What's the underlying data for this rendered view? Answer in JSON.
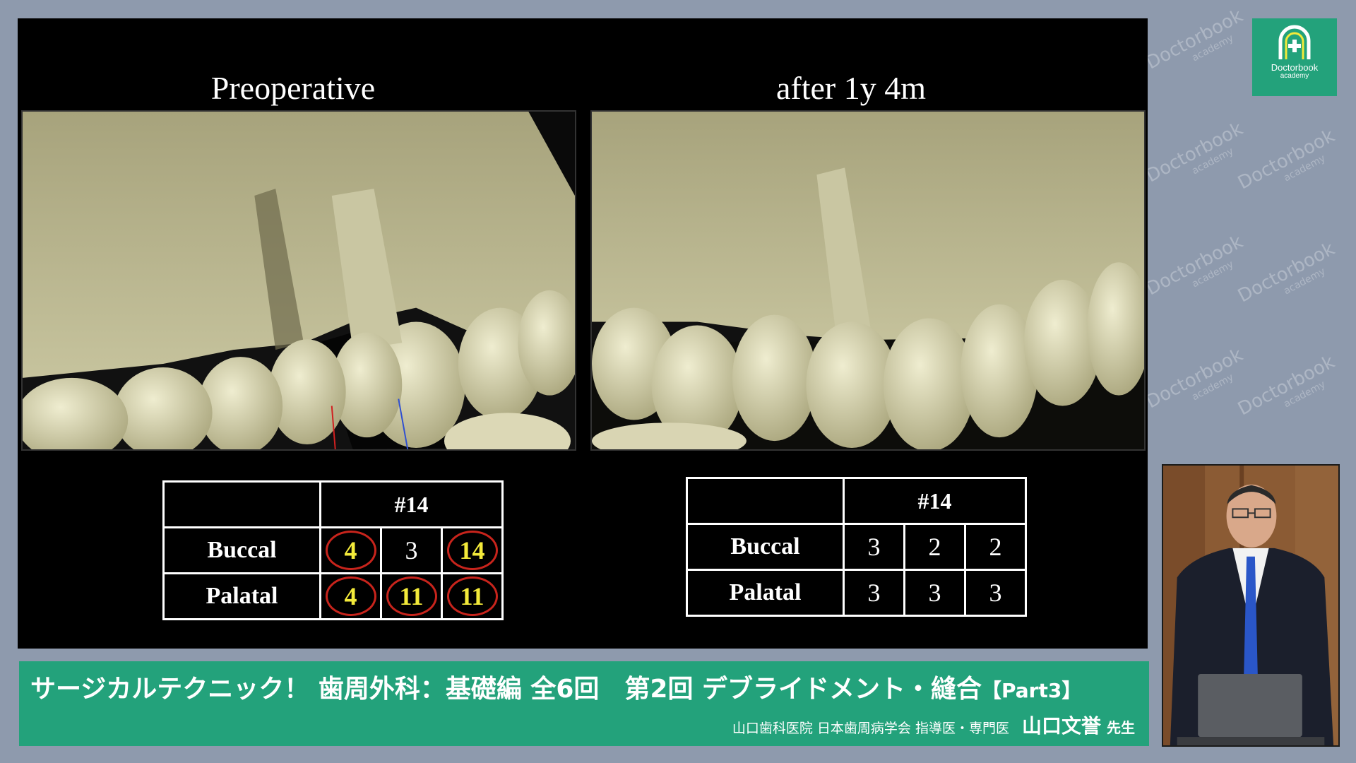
{
  "slide": {
    "left_title": "Preoperative",
    "right_title": "after 1y 4m",
    "left_table": {
      "header": "#14",
      "rows": [
        {
          "label": "Buccal",
          "values": [
            "4",
            "3",
            "14"
          ],
          "circled": [
            true,
            false,
            true
          ]
        },
        {
          "label": "Palatal",
          "values": [
            "4",
            "11",
            "11"
          ],
          "circled": [
            true,
            true,
            true
          ]
        }
      ]
    },
    "right_table": {
      "header": "#14",
      "rows": [
        {
          "label": "Buccal",
          "values": [
            "3",
            "2",
            "2"
          ]
        },
        {
          "label": "Palatal",
          "values": [
            "3",
            "3",
            "3"
          ]
        }
      ]
    }
  },
  "banner": {
    "title": "サージカルテクニック！ 歯周外科：基礎編 全6回　第2回 デブライドメント・縫合",
    "part": "【Part3】",
    "affiliation": "山口歯科医院 日本歯周病学会 指導医・専門医",
    "presenter": "山口文誉",
    "honorific": "先生"
  },
  "logo": {
    "name": "Doctorbook",
    "sub": "academy",
    "brand_color": "#23a27b"
  },
  "colors": {
    "circle_stroke": "#c8241c",
    "circled_number": "#f3ea3a",
    "background": "#8e9aad"
  }
}
